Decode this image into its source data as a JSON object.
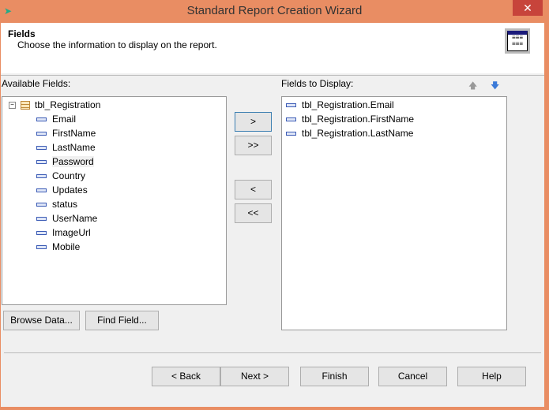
{
  "window": {
    "title": "Standard Report Creation Wizard",
    "close": "✕"
  },
  "header": {
    "title": "Fields",
    "subtitle": "Choose the information to display on the report."
  },
  "available": {
    "label": "Available Fields:",
    "table": "tbl_Registration",
    "fields": [
      "Email",
      "FirstName",
      "LastName",
      "Password",
      "Country",
      "Updates",
      "status",
      "UserName",
      "ImageUrl",
      "Mobile"
    ]
  },
  "display": {
    "label": "Fields to Display:",
    "fields": [
      "tbl_Registration.Email",
      "tbl_Registration.FirstName",
      "tbl_Registration.LastName"
    ],
    "up": "🡅",
    "down": "🡇"
  },
  "move": {
    "add": ">",
    "add_all": ">>",
    "remove": "<",
    "remove_all": "<<"
  },
  "buttons": {
    "browse": "Browse Data...",
    "find": "Find Field...",
    "back": "< Back",
    "next": "Next >",
    "finish": "Finish",
    "cancel": "Cancel",
    "help": "Help"
  }
}
